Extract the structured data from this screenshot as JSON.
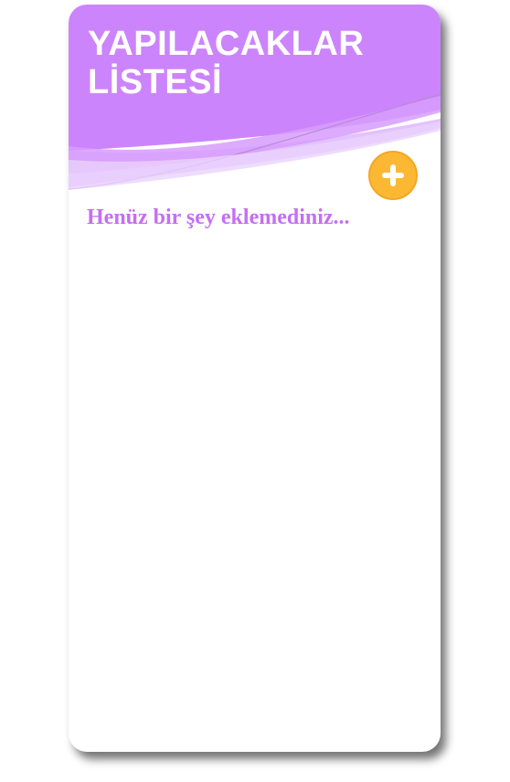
{
  "app": {
    "title_line1": "YAPILACAKLAR",
    "title_line2": "LİSTESİ"
  },
  "actions": {
    "add_icon": "plus-icon"
  },
  "list": {
    "empty_message": "Henüz bir şey eklemediniz..."
  },
  "colors": {
    "header_purple": "#cc84fc",
    "wave_light": "#e3c1fd",
    "add_button": "#fdb833",
    "empty_text": "#c56ff2",
    "title_text": "#ffffff"
  }
}
